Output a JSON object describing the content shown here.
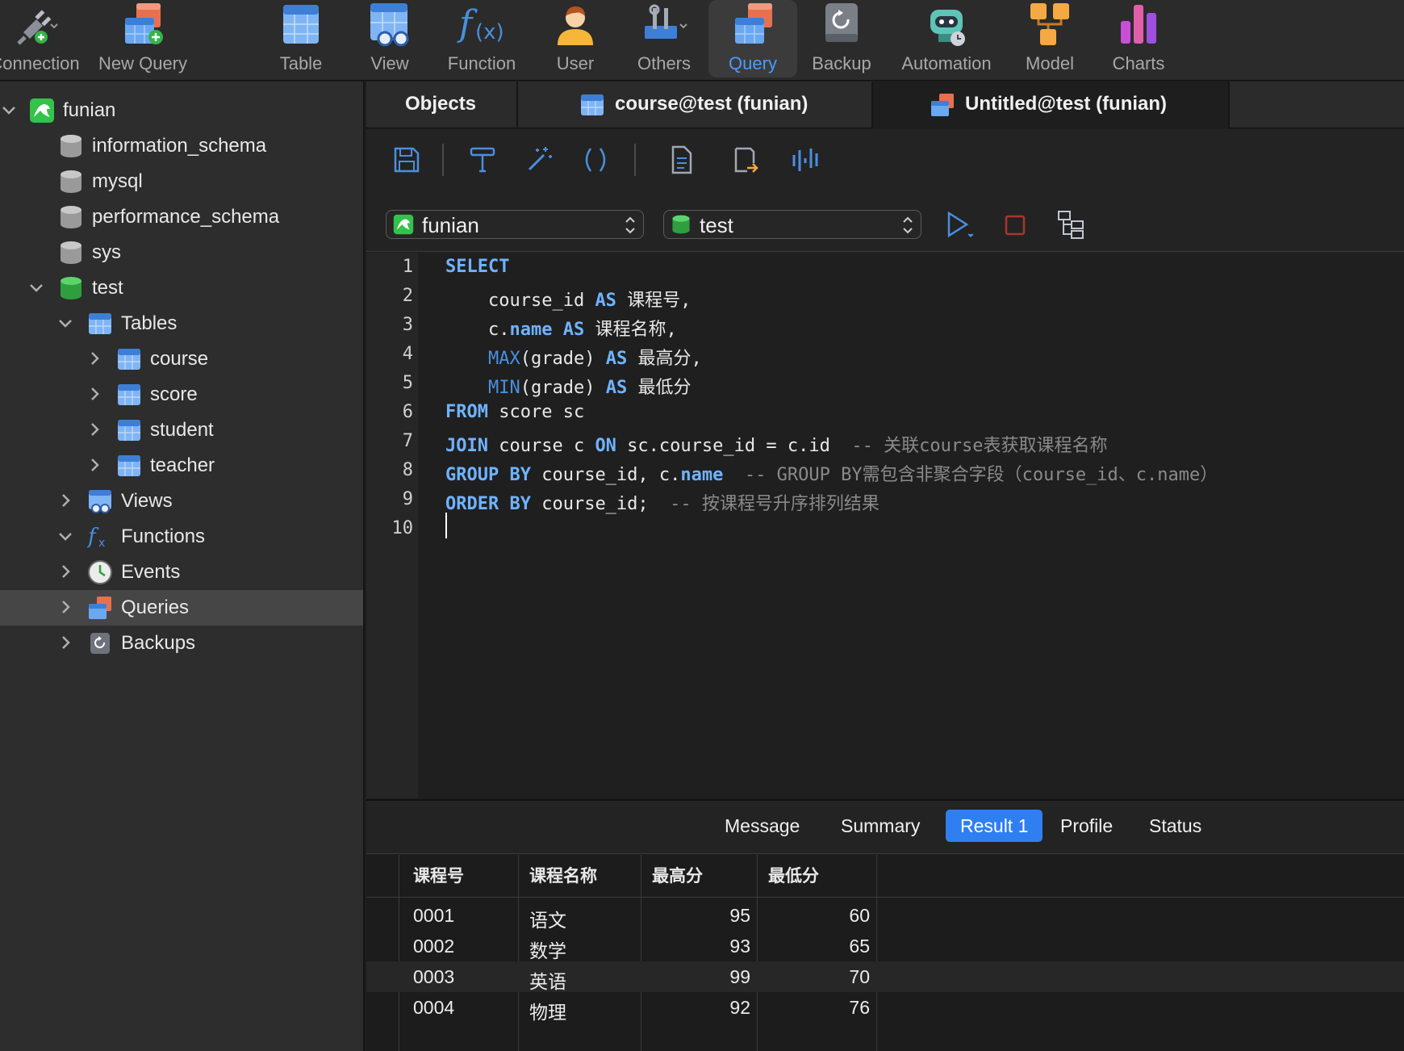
{
  "toolbar": {
    "items": [
      {
        "label": "Connection",
        "icon": "connection-plug-icon"
      },
      {
        "label": "New Query",
        "icon": "new-query-icon"
      },
      {
        "label": "Table",
        "icon": "table-icon"
      },
      {
        "label": "View",
        "icon": "view-icon"
      },
      {
        "label": "Function",
        "icon": "function-fx-icon"
      },
      {
        "label": "User",
        "icon": "user-icon"
      },
      {
        "label": "Others",
        "icon": "tools-icon"
      },
      {
        "label": "Query",
        "icon": "query-icon",
        "active": true
      },
      {
        "label": "Backup",
        "icon": "backup-icon"
      },
      {
        "label": "Automation",
        "icon": "robot-icon"
      },
      {
        "label": "Model",
        "icon": "model-icon"
      },
      {
        "label": "Charts",
        "icon": "charts-icon"
      }
    ]
  },
  "sidebar": {
    "connection": "funian",
    "databases": [
      "information_schema",
      "mysql",
      "performance_schema",
      "sys",
      "test"
    ],
    "test_children": {
      "tables_label": "Tables",
      "tables": [
        "course",
        "score",
        "student",
        "teacher"
      ],
      "views": "Views",
      "functions": "Functions",
      "events": "Events",
      "queries": "Queries",
      "backups": "Backups"
    }
  },
  "tabs": [
    {
      "label": "Objects"
    },
    {
      "label": "course@test (funian)"
    },
    {
      "label": "Untitled@test (funian)",
      "active": true
    }
  ],
  "editor": {
    "connection_select": "funian",
    "database_select": "test",
    "line_numbers": [
      "1",
      "2",
      "3",
      "4",
      "5",
      "6",
      "7",
      "8",
      "9",
      "10"
    ]
  },
  "result_tabs": [
    "Message",
    "Summary",
    "Result 1",
    "Profile",
    "Status"
  ],
  "active_result_tab": "Result 1",
  "grid": {
    "columns": [
      "课程号",
      "课程名称",
      "最高分",
      "最低分"
    ],
    "rows": [
      [
        "0001",
        "语文",
        "95",
        "60"
      ],
      [
        "0002",
        "数学",
        "93",
        "65"
      ],
      [
        "0003",
        "英语",
        "99",
        "70"
      ],
      [
        "0004",
        "物理",
        "92",
        "76"
      ]
    ]
  },
  "colors": {
    "accent": "#2f7ff0",
    "keyword": "#6fb3ff",
    "comment": "#8a8a8a"
  }
}
